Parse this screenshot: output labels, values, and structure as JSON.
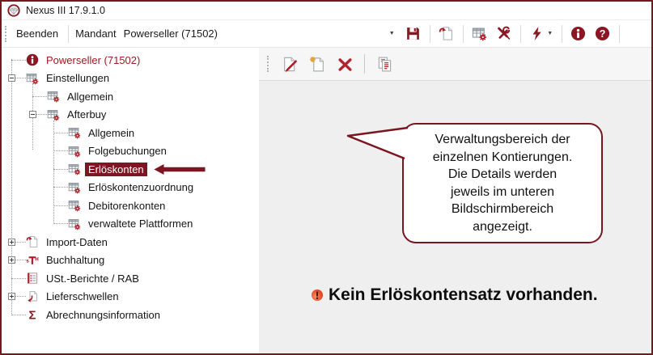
{
  "window": {
    "title": "Nexus III 17.9.1.0",
    "app_icon": "gem-logo-icon"
  },
  "toolbar": {
    "beenden_label": "Beenden",
    "mandant_label": "Mandant",
    "mandant_value": "Powerseller (71502)",
    "icons": [
      "save-icon",
      "import-document-icon",
      "table-settings-icon",
      "tools-icon",
      "lightning-icon",
      "info-icon",
      "help-icon"
    ]
  },
  "tree": {
    "items": [
      {
        "label": "Powerseller (71502)",
        "level": 0,
        "icon": "info",
        "expander": "none",
        "accent": true
      },
      {
        "label": "Einstellungen",
        "level": 0,
        "icon": "table-settings",
        "expander": "minus"
      },
      {
        "label": "Allgemein",
        "level": 1,
        "icon": "table-settings",
        "expander": "none"
      },
      {
        "label": "Afterbuy",
        "level": 1,
        "icon": "table-settings",
        "expander": "minus"
      },
      {
        "label": "Allgemein",
        "level": 2,
        "icon": "table-settings",
        "expander": "none"
      },
      {
        "label": "Folgebuchungen",
        "level": 2,
        "icon": "table-settings",
        "expander": "none"
      },
      {
        "label": "Erlöskonten",
        "level": 2,
        "icon": "table-settings",
        "expander": "none",
        "selected": true,
        "arrow": true
      },
      {
        "label": "Erlöskontenzuordnung",
        "level": 2,
        "icon": "table-settings",
        "expander": "none"
      },
      {
        "label": "Debitorenkonten",
        "level": 2,
        "icon": "table-settings",
        "expander": "none"
      },
      {
        "label": "verwaltete Plattformen",
        "level": 2,
        "icon": "table-settings",
        "expander": "none"
      },
      {
        "label": "Import-Daten",
        "level": 0,
        "icon": "import-document",
        "expander": "plus"
      },
      {
        "label": "Buchhaltung",
        "level": 0,
        "icon": "t-account",
        "expander": "plus"
      },
      {
        "label": "USt.-Berichte / RAB",
        "level": 0,
        "icon": "report",
        "expander": "none"
      },
      {
        "label": "Lieferschwellen",
        "level": 0,
        "icon": "page-return",
        "expander": "plus"
      },
      {
        "label": "Abrechnungsinformation",
        "level": 0,
        "icon": "sigma",
        "expander": "none"
      }
    ]
  },
  "panel": {
    "toolbar_icons": [
      "edit-icon",
      "new-record-icon",
      "delete-icon",
      "copy-icon"
    ],
    "callout_text": "Verwaltungsbereich der\neinzelnen Kontierungen.\nDie Details werden\njeweils im unteren\nBildschirmbereich\nangezeigt.",
    "warning_text": "Kein Erlöskontensatz vorhanden."
  },
  "colors": {
    "accent": "#8a1722",
    "window_border": "#7a1520",
    "selection_bg": "#7d1622",
    "warning_icon": "#d9441f",
    "panel_bg": "#efefef"
  }
}
